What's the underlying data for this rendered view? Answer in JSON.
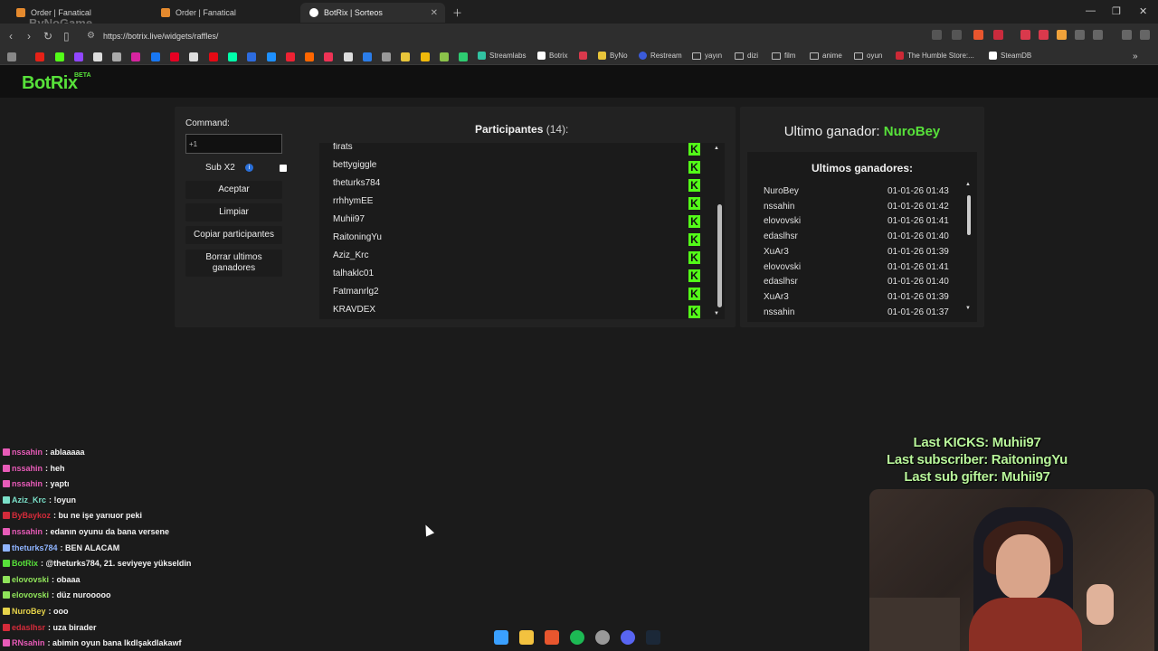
{
  "browser": {
    "tabs": [
      {
        "title": "Order | Fanatical",
        "active": false,
        "favicon_color": "#e58a2e"
      },
      {
        "title": "Order | Fanatical",
        "active": false,
        "favicon_color": "#e58a2e"
      },
      {
        "title": "BotRix | Sorteos",
        "active": true,
        "favicon_color": "#ffffff"
      }
    ],
    "watermark": "ByNoGame",
    "url": "https://botrix.live/widgets/raffles/",
    "bookmarks": [
      {
        "label": "Streamlabs",
        "icon": "streamlabs-icon",
        "color": "#31c3a2"
      },
      {
        "label": "Botrix",
        "icon": "botrix-icon",
        "color": "#ffffff"
      },
      {
        "label": "ByNo",
        "icon": "byno-icon",
        "color": "#e8c53a"
      },
      {
        "label": "Restream",
        "icon": "restream-icon",
        "color": "#3b5bdb"
      },
      {
        "label": "yayın",
        "icon": "folder-icon",
        "color": "#bbbbbb"
      },
      {
        "label": "dizi",
        "icon": "folder-icon",
        "color": "#bbbbbb"
      },
      {
        "label": "film",
        "icon": "folder-icon",
        "color": "#bbbbbb"
      },
      {
        "label": "anime",
        "icon": "folder-icon",
        "color": "#bbbbbb"
      },
      {
        "label": "oyun",
        "icon": "folder-icon",
        "color": "#bbbbbb"
      },
      {
        "label": "The Humble Store:...",
        "icon": "humble-icon",
        "color": "#cc2936"
      },
      {
        "label": "SteamDB",
        "icon": "steamdb-icon",
        "color": "#ffffff"
      }
    ]
  },
  "site": {
    "logo": "BotRix",
    "logo_badge": "BETA",
    "accent": "#57e13a"
  },
  "raffle": {
    "command_label": "Command:",
    "command_value": "+1",
    "sub_label": "Sub X2",
    "buttons": {
      "accept": "Aceptar",
      "clear": "Limpiar",
      "copy": "Copiar participantes",
      "delete_winners": "Borrar ultimos ganadores"
    },
    "participants_title": "Participantes",
    "participants_count": "(14):",
    "participants": [
      "firats",
      "bettygiggle",
      "theturks784",
      "rrhhymEE",
      "Muhii97",
      "RaitoningYu",
      "Aziz_Krc",
      "talhaklc01",
      "Fatmanrlg2",
      "KRAVDEX"
    ],
    "kick_glyph": "K"
  },
  "winners": {
    "last_winner_label": "Ultimo ganador:",
    "last_winner_name": "NuroBey",
    "list_title": "Ultimos ganadores:",
    "list": [
      {
        "name": "NuroBey",
        "date": "01-01-26 01:43"
      },
      {
        "name": "nssahin",
        "date": "01-01-26 01:42"
      },
      {
        "name": "elovovski",
        "date": "01-01-26 01:41"
      },
      {
        "name": "edaslhsr",
        "date": "01-01-26 01:40"
      },
      {
        "name": "XuAr3",
        "date": "01-01-26 01:39"
      },
      {
        "name": "elovovski",
        "date": "01-01-26 01:41"
      },
      {
        "name": "edaslhsr",
        "date": "01-01-26 01:40"
      },
      {
        "name": "XuAr3",
        "date": "01-01-26 01:39"
      },
      {
        "name": "nssahin",
        "date": "01-01-26 01:37"
      }
    ]
  },
  "chat": [
    {
      "user": "nssahin",
      "color": "#e85bb8",
      "msg": ": ablaaaaa"
    },
    {
      "user": "nssahin",
      "color": "#e85bb8",
      "msg": ": heh"
    },
    {
      "user": "nssahin",
      "color": "#e85bb8",
      "msg": ": yaptı"
    },
    {
      "user": "Aziz_Krc",
      "color": "#7be0c9",
      "msg": ": !oyun"
    },
    {
      "user": "ByBaykoz",
      "color": "#d42b3a",
      "msg": ": bu ne işe yarıuor peki"
    },
    {
      "user": "nssahin",
      "color": "#e85bb8",
      "msg": ": edanın oyunu da bana versene"
    },
    {
      "user": "theturks784",
      "color": "#8fb4ff",
      "msg": ": BEN ALACAM"
    },
    {
      "user": "BotRix",
      "color": "#57e13a",
      "msg": ": @theturks784, 21. seviyeye yükseldin"
    },
    {
      "user": "elovovski",
      "color": "#8fe35a",
      "msg": ": obaaa"
    },
    {
      "user": "elovovski",
      "color": "#8fe35a",
      "msg": ": düz nurooooo"
    },
    {
      "user": "NuroBey",
      "color": "#e6d34a",
      "msg": ": ooo"
    },
    {
      "user": "edaslhsr",
      "color": "#d42b3a",
      "msg": ": uza birader"
    },
    {
      "user": "RNsahin",
      "color": "#e85bb8",
      "msg": ": abimin oyun bana lkdlşakdlakawf"
    }
  ],
  "alerts": {
    "kicks": "Last KICKS: Muhii97",
    "subscriber": "Last subscriber: RaitoningYu",
    "sub_gifter": "Last sub gifter: Muhii97"
  }
}
